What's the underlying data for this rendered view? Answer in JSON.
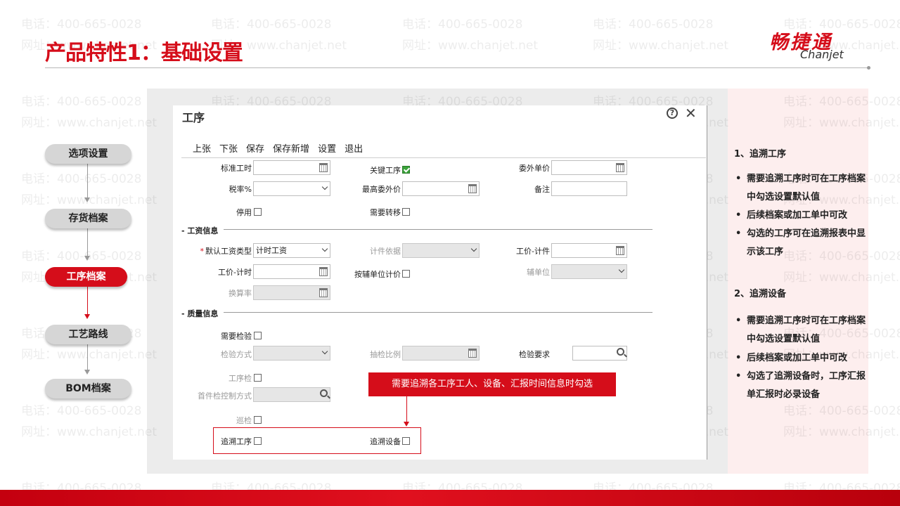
{
  "watermark": {
    "phone": "电话：400-665-0028",
    "site": "网址：www.chanjet.net"
  },
  "slide": {
    "title": "产品特性1：基础设置",
    "logo_cn": "畅捷通",
    "logo_en": "Chanjet"
  },
  "flow": {
    "steps": [
      "选项设置",
      "存货档案",
      "工序档案",
      "工艺路线",
      "BOM档案"
    ],
    "active_step": "工序档案"
  },
  "dialog": {
    "title": "工序",
    "help_icon": "help-icon",
    "close_icon": "close-icon",
    "toolbar": [
      "上张",
      "下张",
      "保存",
      "保存新增",
      "设置",
      "退出"
    ],
    "fields": {
      "std_hours": "标准工时",
      "key_process": "关键工序",
      "outsource_price": "委外单价",
      "tax_rate": "税率%",
      "max_outsource_price": "最高委外价",
      "remark": "备注",
      "disabled": "停用",
      "need_transfer": "需要转移",
      "wage_type": "默认工资类型",
      "wage_type_value": "计时工资",
      "piece_basis": "计件依据",
      "piece_price": "工价-计件",
      "time_price": "工价-计时",
      "by_aux_unit": "按辅单位计价",
      "aux_unit": "辅单位",
      "conversion_rate": "换算率",
      "need_inspection": "需要检验",
      "inspection_method": "检验方式",
      "sampling_ratio": "抽检比例",
      "inspection_req": "检验要求",
      "process_inspection": "工序检",
      "first_inspection_mode": "首件检控制方式",
      "patrol_inspection": "巡检",
      "trace_process": "追溯工序",
      "trace_equipment": "追溯设备"
    },
    "sections": {
      "wage": "工资信息",
      "quality": "质量信息"
    },
    "key_process_checked": true
  },
  "callout": {
    "text": "需要追溯各工序工人、设备、汇报时间信息时勾选"
  },
  "notes": {
    "section1_title": "1、追溯工序",
    "section1_items": [
      "需要追溯工序时可在工序档案中勾选设置默认值",
      "后续档案或加工单中可改",
      "勾选的工序可在追溯报表中显示该工序"
    ],
    "section2_title": "2、追溯设备",
    "section2_items": [
      "需要追溯工序时可在工序档案中勾选设置默认值",
      "后续档案或加工单中可改",
      "勾选了追溯设备时，工序汇报单汇报时必录设备"
    ]
  },
  "colors": {
    "brand_red": "#d50d1a",
    "panel_gray": "#ececec",
    "panel_pink": "#fdeeee"
  }
}
